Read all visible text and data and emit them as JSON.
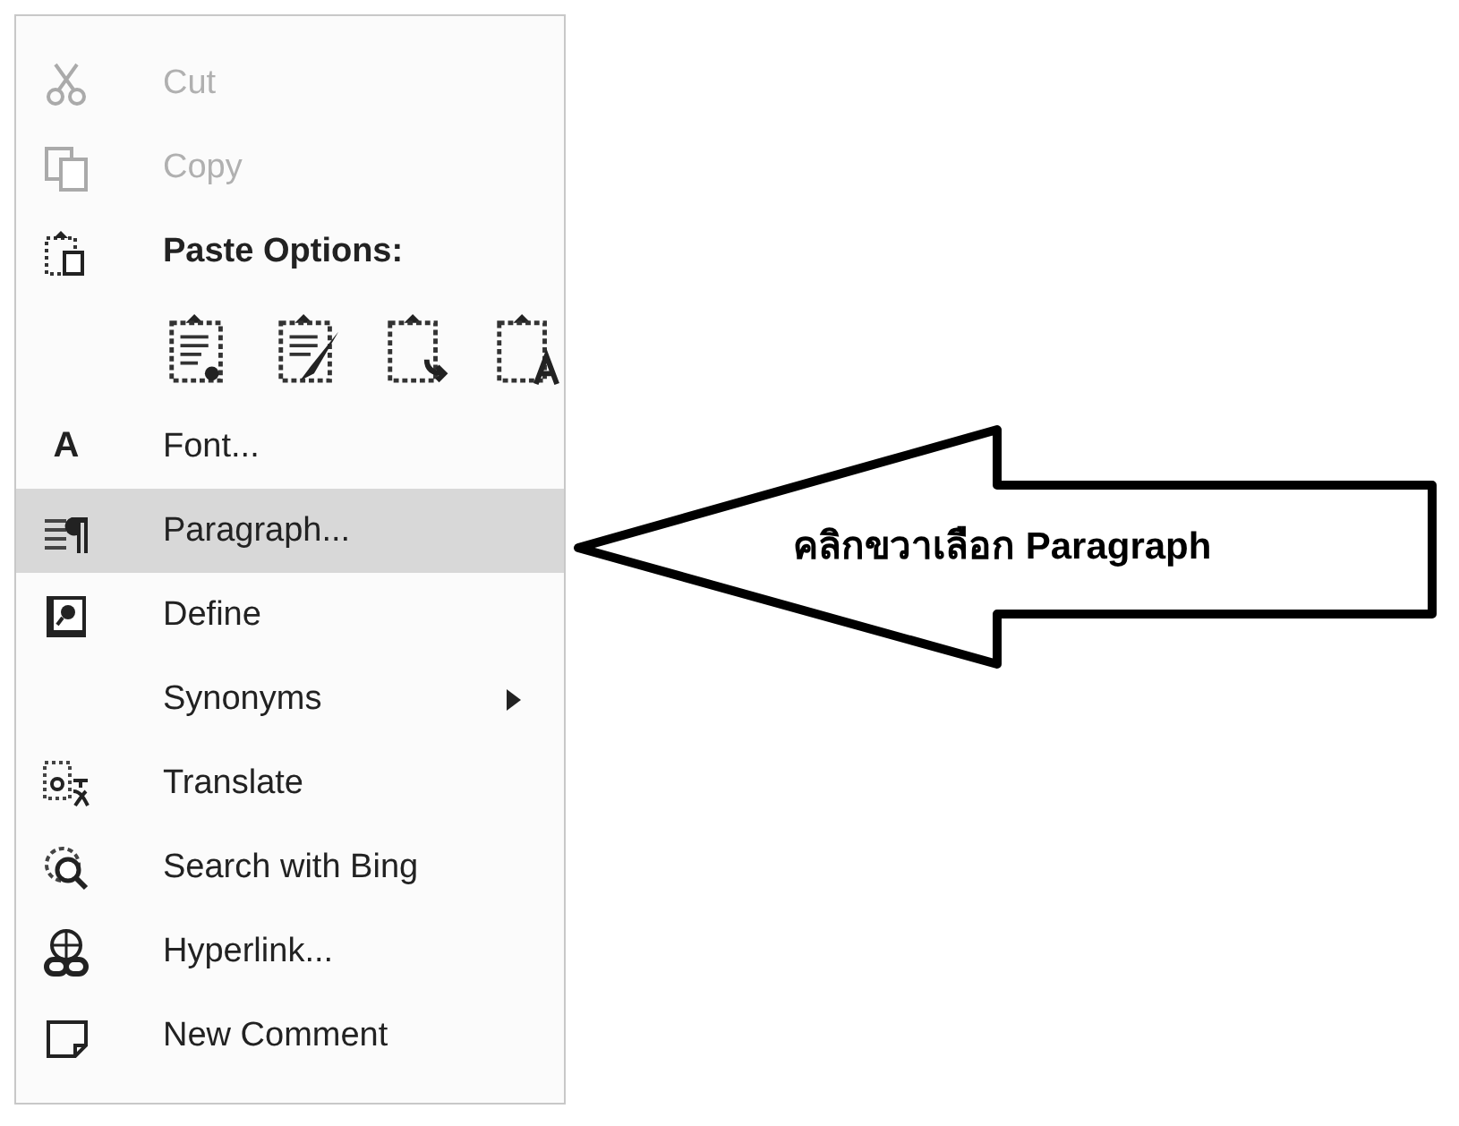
{
  "context_menu": {
    "items": [
      {
        "kind": "item",
        "label": "Cut",
        "disabled": true,
        "selected": false
      },
      {
        "kind": "item",
        "label": "Copy",
        "disabled": true,
        "selected": false
      },
      {
        "kind": "header",
        "label": "Paste Options:"
      },
      {
        "kind": "paste_icons"
      },
      {
        "kind": "item",
        "label": "Font...",
        "icon_text": "A",
        "disabled": false,
        "selected": false
      },
      {
        "kind": "item",
        "label": "Paragraph...",
        "disabled": false,
        "selected": true
      },
      {
        "kind": "item",
        "label": "Define",
        "disabled": false,
        "selected": false
      },
      {
        "kind": "submenu",
        "label": "Synonyms",
        "disabled": false,
        "selected": false
      },
      {
        "kind": "item",
        "label": "Translate",
        "disabled": false,
        "selected": false
      },
      {
        "kind": "item",
        "label": "Search with Bing",
        "disabled": false,
        "selected": false
      },
      {
        "kind": "item",
        "label": "Hyperlink...",
        "disabled": false,
        "selected": false
      },
      {
        "kind": "item",
        "label": "New Comment",
        "disabled": false,
        "selected": false
      }
    ]
  },
  "callout": {
    "text": "คลิกขวาเลือก Paragraph"
  }
}
